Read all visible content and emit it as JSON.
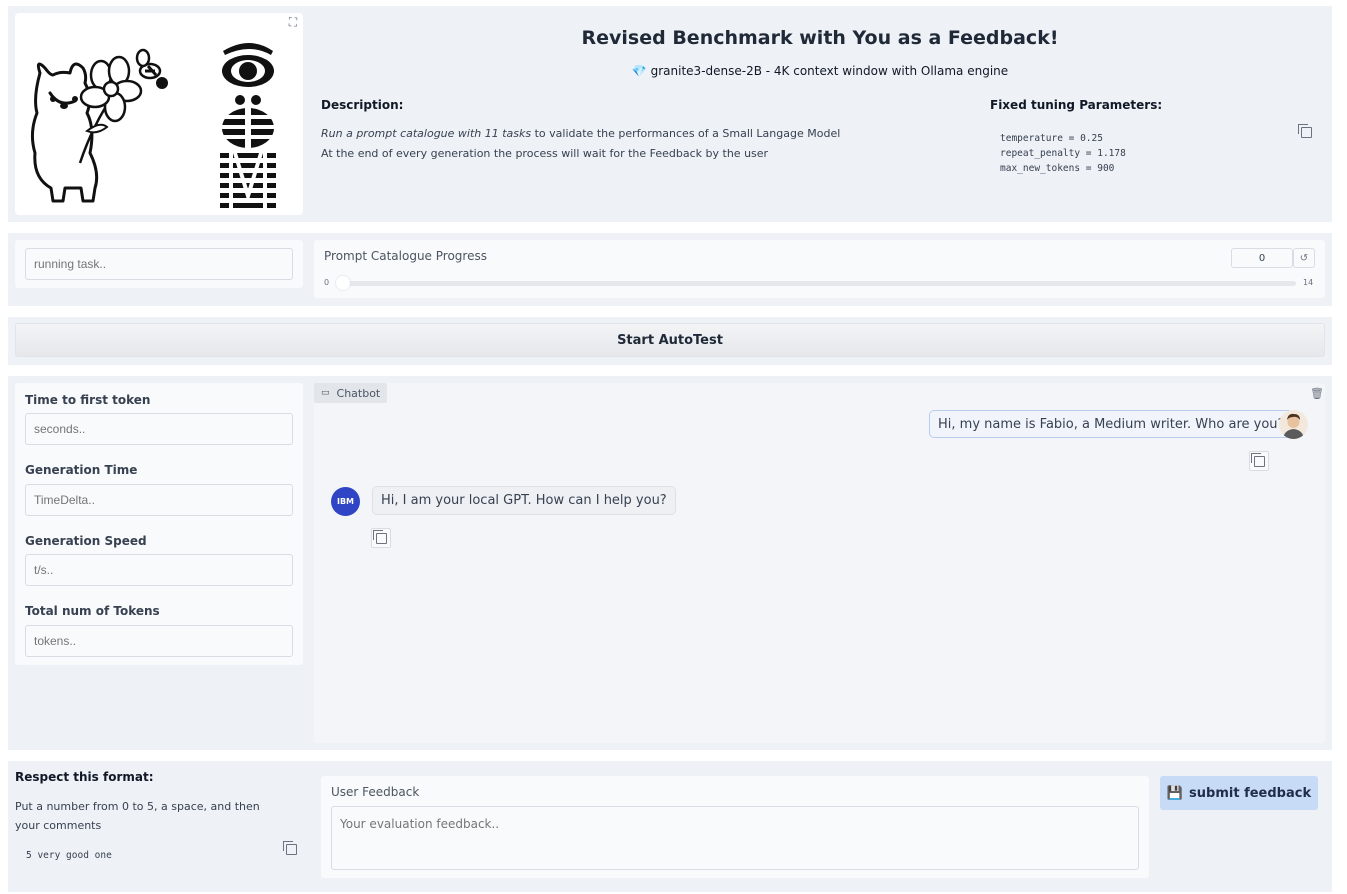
{
  "header": {
    "title": "Revised Benchmark with You as a Feedback!",
    "subtitle_icon": "gem-icon",
    "subtitle": "granite3-dense-2B - 4K context window with Ollama engine",
    "description_heading": "Description:",
    "description_line1_italic": "Run a prompt catalogue with 11 tasks",
    "description_line1_rest": " to validate the performances of a Small Langage Model",
    "description_line2": "At the end of every generation the process will wait for the Feedback by the user",
    "params_heading": "Fixed tuning Parameters:",
    "params": [
      "temperature = 0.25",
      "repeat_penalty = 1.178",
      "max_new_tokens = 900"
    ]
  },
  "progress": {
    "running_task_placeholder": "running task..",
    "label": "Prompt Catalogue Progress",
    "value": "0",
    "min_label": "0",
    "max_label": "14",
    "fraction": 0
  },
  "start_button": "Start AutoTest",
  "metrics": {
    "ttft_label": "Time to first token",
    "ttft_placeholder": "seconds..",
    "gen_time_label": "Generation Time",
    "gen_time_placeholder": "TimeDelta..",
    "gen_speed_label": "Generation Speed",
    "gen_speed_placeholder": "t/s..",
    "tokens_label": "Total num of Tokens",
    "tokens_placeholder": "tokens.."
  },
  "chatbot": {
    "label": "Chatbot",
    "user_message": "Hi, my name is Fabio, a Medium writer. Who are you?",
    "bot_avatar_text": "IBM",
    "bot_message": "Hi, I am your local GPT. How can I help you?"
  },
  "feedback": {
    "format_heading": "Respect this format:",
    "format_text": "Put a number from 0 to 5, a space, and then your comments",
    "example": "5 very good one",
    "field_label": "User Feedback",
    "field_placeholder": "Your evaluation feedback..",
    "submit_label": "submit feedback"
  },
  "colors": {
    "panel_bg": "#eef1f5",
    "submit_bg": "#c7dbf7",
    "ibm_avatar": "#2f45c5"
  }
}
